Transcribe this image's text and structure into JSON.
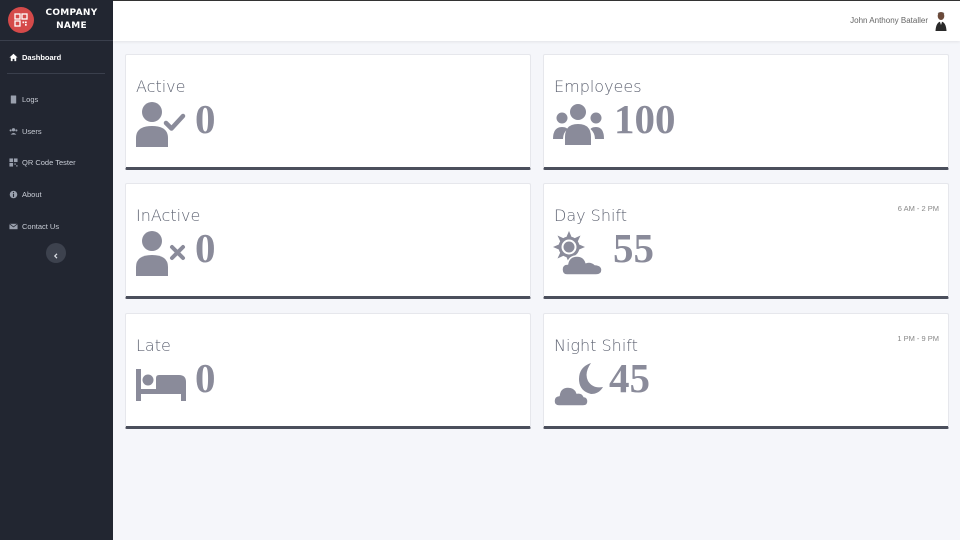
{
  "brand": {
    "name_line1": "COMPANY",
    "name_line2": "NAME",
    "logo_icon": "qr-code-icon",
    "accent": "#d54a4a"
  },
  "sidebar": {
    "items": [
      {
        "label": "Dashboard",
        "icon": "home-icon",
        "active": true
      },
      {
        "label": "Logs",
        "icon": "file-icon"
      },
      {
        "label": "Users",
        "icon": "users-icon"
      },
      {
        "label": "QR Code Tester",
        "icon": "qr-code-icon"
      },
      {
        "label": "About",
        "icon": "info-icon"
      },
      {
        "label": "Contact Us",
        "icon": "envelope-icon"
      }
    ],
    "collapse_icon": "chevron-left-icon"
  },
  "topbar": {
    "user_name": "John Anthony Bataller"
  },
  "cards": {
    "active": {
      "title": "Active",
      "value": "0",
      "icon": "user-check-icon"
    },
    "employees": {
      "title": "Employees",
      "value": "100",
      "icon": "users-icon"
    },
    "inactive": {
      "title": "InActive",
      "value": "0",
      "icon": "user-times-icon"
    },
    "day_shift": {
      "title": "Day Shift",
      "value": "55",
      "time": "6 AM - 2 PM",
      "icon": "cloud-sun-icon"
    },
    "late": {
      "title": "Late",
      "value": "0",
      "icon": "bed-icon"
    },
    "night_shift": {
      "title": "Night Shift",
      "value": "45",
      "time": "1 PM - 9 PM",
      "icon": "cloud-moon-icon"
    }
  },
  "colors": {
    "sidebar_bg": "#222631",
    "icon_gray": "#8a8b9a",
    "card_border": "#4b4f5c"
  }
}
